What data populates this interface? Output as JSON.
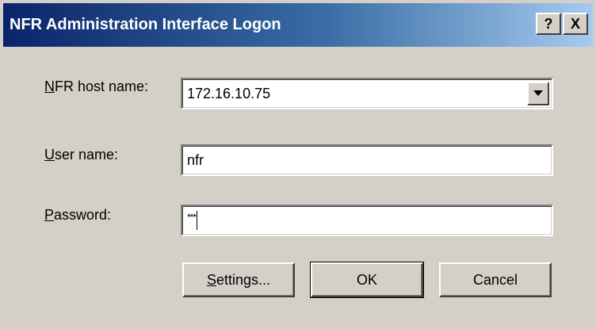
{
  "window": {
    "title": "NFR Administration Interface Logon",
    "help_label": "?",
    "close_label": "X"
  },
  "form": {
    "host_label": "NFR host name:",
    "host_mnemonic": "N",
    "host_rest": "FR host name:",
    "host_value": "172.16.10.75",
    "user_label": "User name:",
    "user_mnemonic": "U",
    "user_rest": "ser name:",
    "user_value": "nfr",
    "password_label": "Password:",
    "password_mnemonic": "P",
    "password_rest": "assword:",
    "password_mask": "***"
  },
  "buttons": {
    "settings_label": "Settings...",
    "settings_mnemonic": "S",
    "settings_rest": "ettings...",
    "ok_label": "OK",
    "cancel_label": "Cancel"
  },
  "colors": {
    "dialog_face": "#d4d0c8",
    "title_active": "#0a246a"
  }
}
